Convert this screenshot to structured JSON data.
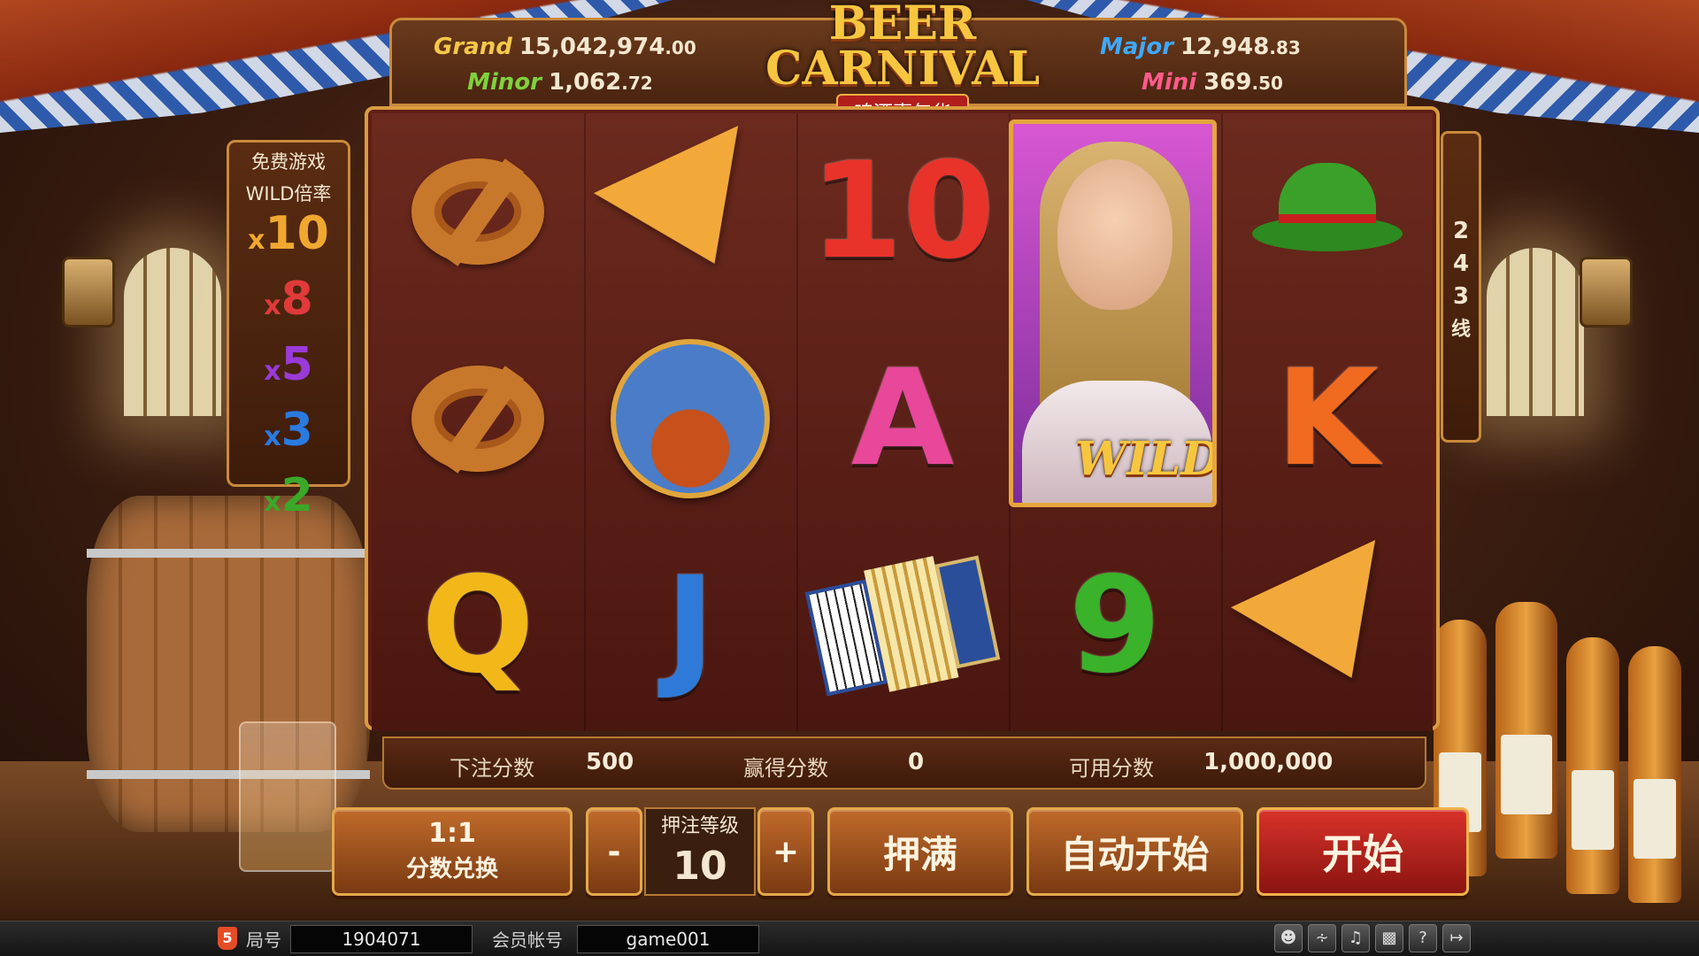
{
  "jackpots": {
    "grand": {
      "name": "Grand",
      "int": "15,042,974",
      "dec": ".00"
    },
    "minor": {
      "name": "Minor",
      "int": "1,062",
      "dec": ".72"
    },
    "major": {
      "name": "Major",
      "int": "12,948",
      "dec": ".83"
    },
    "mini": {
      "name": "Mini",
      "int": "369",
      "dec": ".50"
    }
  },
  "logo": {
    "line1": "BEER",
    "line2": "CARNIVAL",
    "subtitle": "啤酒嘉年华"
  },
  "multiplier_panel": {
    "title_line1": "免费游戏",
    "title_line2": "WILD倍率",
    "items": [
      {
        "x": "x",
        "value": "10",
        "color": "#f0a830"
      },
      {
        "x": "x",
        "value": "8",
        "color": "#e03a3a"
      },
      {
        "x": "x",
        "value": "5",
        "color": "#9a3ad8"
      },
      {
        "x": "x",
        "value": "3",
        "color": "#2a7ae0"
      },
      {
        "x": "x",
        "value": "2",
        "color": "#3aa828"
      }
    ]
  },
  "lines_indicator": {
    "d1": "2",
    "d2": "4",
    "d3": "3",
    "unit": "线"
  },
  "reels": {
    "wild_label": "WILD",
    "symbols": [
      [
        "pretzel",
        "pretzel",
        "Q"
      ],
      [
        "pizza",
        "beer-man",
        "J"
      ],
      [
        "10",
        "A",
        "accordion"
      ],
      [
        "wild-girl",
        "wild-girl",
        "9"
      ],
      [
        "hat",
        "K",
        "pizza"
      ]
    ],
    "letters": {
      "ten": {
        "text": "10",
        "color": "#e8332a"
      },
      "a": {
        "text": "A",
        "color": "#e8479a"
      },
      "q": {
        "text": "Q",
        "color": "#f2b81a"
      },
      "j": {
        "text": "J",
        "color": "#2f7ad8"
      },
      "nine": {
        "text": "9",
        "color": "#3ab22a"
      },
      "k": {
        "text": "K",
        "color": "#f06a20"
      }
    }
  },
  "info_bar": {
    "bet_label": "下注分数",
    "bet_value": "500",
    "win_label": "赢得分数",
    "win_value": "0",
    "credit_label": "可用分数",
    "credit_value": "1,000,000"
  },
  "controls": {
    "exchange_ratio": "1:1",
    "exchange_label": "分数兑换",
    "minus": "-",
    "plus": "+",
    "level_label": "押注等级",
    "level_value": "10",
    "max_bet": "押满",
    "auto_start": "自动开始",
    "start": "开始"
  },
  "status_bar": {
    "html5_badge": "5",
    "round_label": "局号",
    "round_value": "1904071",
    "account_label": "会员帐号",
    "account_value": "game001",
    "icons": [
      "user-icon",
      "rss-icon",
      "music-icon",
      "gift-icon",
      "help-icon",
      "exit-icon"
    ]
  }
}
